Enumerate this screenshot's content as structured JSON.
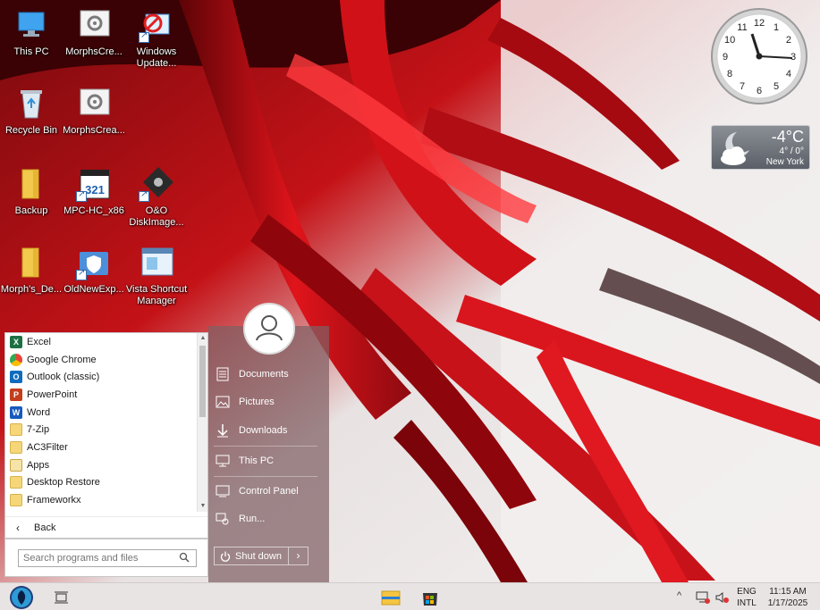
{
  "desktop": {
    "icons": [
      {
        "label": "This PC"
      },
      {
        "label": "MorphsCre..."
      },
      {
        "label": "Windows Update..."
      },
      {
        "label": "Recycle Bin"
      },
      {
        "label": "MorphsCrea..."
      },
      {
        "label": "Backup"
      },
      {
        "label": "MPC-HC_x86"
      },
      {
        "label": "O&O DiskImage..."
      },
      {
        "label": "Morph's_De..."
      },
      {
        "label": "OldNewExp..."
      },
      {
        "label": "Vista Shortcut Manager"
      }
    ],
    "mpc_badge": "321"
  },
  "gadgets": {
    "clock": {
      "numbers": [
        "12",
        "1",
        "2",
        "3",
        "4",
        "5",
        "6",
        "7",
        "8",
        "9",
        "10",
        "11"
      ]
    },
    "weather": {
      "temp": "-4°C",
      "range": "4° / 0°",
      "city": "New York"
    }
  },
  "start_menu": {
    "programs": [
      {
        "label": "Excel",
        "icon": "excel-icon",
        "badge": "X",
        "color": "#1d7044"
      },
      {
        "label": "Google Chrome",
        "icon": "chrome-icon",
        "badge": "",
        "color": "#4285f4"
      },
      {
        "label": "Outlook (classic)",
        "icon": "outlook-icon",
        "badge": "O",
        "color": "#0f6cbd"
      },
      {
        "label": "PowerPoint",
        "icon": "powerpoint-icon",
        "badge": "P",
        "color": "#c43e1c"
      },
      {
        "label": "Word",
        "icon": "word-icon",
        "badge": "W",
        "color": "#185abd"
      },
      {
        "label": "7-Zip",
        "icon": "folder-icon",
        "badge": "",
        "color": ""
      },
      {
        "label": "AC3Filter",
        "icon": "folder-icon",
        "badge": "",
        "color": ""
      },
      {
        "label": "Apps",
        "icon": "apps-icon",
        "badge": "",
        "color": ""
      },
      {
        "label": "Desktop Restore",
        "icon": "folder-icon",
        "badge": "",
        "color": ""
      },
      {
        "label": "Frameworkx",
        "icon": "folder-icon",
        "badge": "",
        "color": ""
      }
    ],
    "back_label": "Back",
    "search_placeholder": "Search programs and files",
    "places": {
      "documents": "Documents",
      "pictures": "Pictures",
      "downloads": "Downloads",
      "this_pc": "This PC",
      "control_panel": "Control Panel",
      "run": "Run..."
    },
    "shutdown_label": "Shut down",
    "shutdown_arrow": "›"
  },
  "taskbar": {
    "language": {
      "line1": "ENG",
      "line2": "INTL"
    },
    "clock": {
      "time": "11:15 AM",
      "date": "1/17/2025"
    },
    "tray_chevron": "^"
  }
}
